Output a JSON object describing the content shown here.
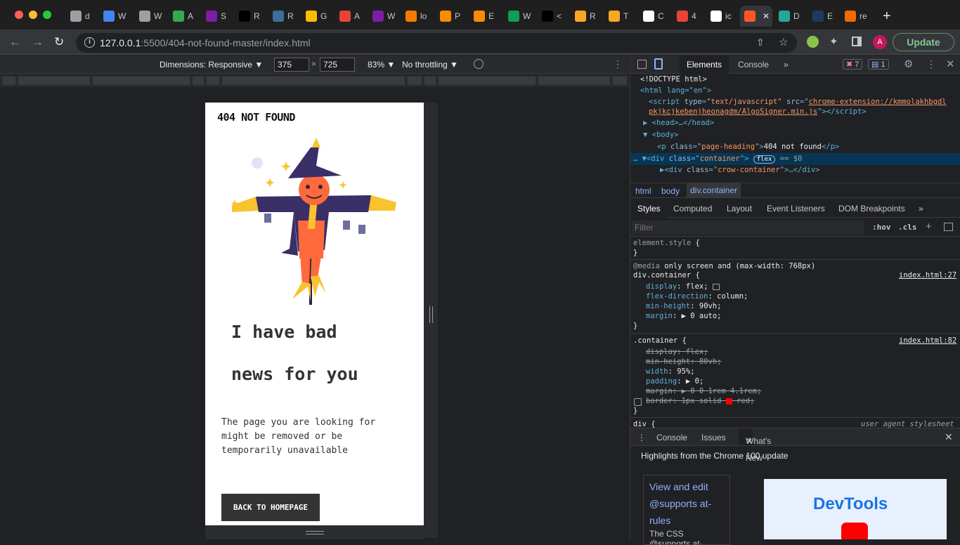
{
  "tabs": [
    {
      "label": "d",
      "color": "#9aa0a6"
    },
    {
      "label": "W",
      "color": "#4285f4"
    },
    {
      "label": "W",
      "color": "#9aa0a6"
    },
    {
      "label": "A",
      "color": "#34a853"
    },
    {
      "label": "S",
      "color": "#7b1fa2"
    },
    {
      "label": "R",
      "color": "#000000"
    },
    {
      "label": "R",
      "color": "#3c6e9f"
    },
    {
      "label": "G",
      "color": "#fbbc04"
    },
    {
      "label": "A",
      "color": "#ea4335"
    },
    {
      "label": "W",
      "color": "#7b1fa2"
    },
    {
      "label": "lo",
      "color": "#f57c00"
    },
    {
      "label": "P",
      "color": "#fb8c00"
    },
    {
      "label": "E",
      "color": "#fb8c00"
    },
    {
      "label": "W",
      "color": "#0f9d58"
    },
    {
      "label": "<",
      "color": "#000000"
    },
    {
      "label": "R",
      "color": "#f9a825"
    },
    {
      "label": "T",
      "color": "#f9a825"
    },
    {
      "label": "C",
      "color": "#ffffff"
    },
    {
      "label": "4",
      "color": "#ea4335"
    },
    {
      "label": "ic",
      "color": "#ffffff"
    },
    {
      "label": "",
      "color": "#ff5722"
    },
    {
      "label": "D",
      "color": "#26a69a"
    },
    {
      "label": "E",
      "color": "#1e3a5f"
    },
    {
      "label": "re",
      "color": "#ef6c00"
    }
  ],
  "address": {
    "host": "127.0.0.1",
    "path": ":5500/404-not-found-master/index.html",
    "update_label": "Update",
    "avatar": "A"
  },
  "device_toolbar": {
    "dimensions": "Dimensions: Responsive ▼",
    "width": "375",
    "height": "725",
    "zoom": "83% ▼",
    "throttle": "No throttling ▼"
  },
  "page": {
    "heading": "404 NOT FOUND",
    "line1": "I have bad",
    "line2": "news for you",
    "description": "The page you are looking for might be removed or be temporarily unavailable",
    "button": "BACK TO HOMEPAGE"
  },
  "devtools": {
    "tabs": [
      "Elements",
      "Console"
    ],
    "errors": "7",
    "messages": "1",
    "dom": {
      "doctype": "<!DOCTYPE html>",
      "html_open": "<html lang=\"en\">",
      "script_src": "chrome-extension://kmmolakhbgdl",
      "script_src2": "pkjkcjkebenjheonagdm/AlgoSigner.min.js",
      "head": "<head>…</head>",
      "body": "<body>",
      "p_text": "404 not found",
      "container": "container",
      "crow": "crow-container"
    },
    "breadcrumbs": [
      "html",
      "body",
      "div.container"
    ],
    "style_tabs": [
      "Styles",
      "Computed",
      "Layout",
      "Event Listeners",
      "DOM Breakpoints"
    ],
    "filter_placeholder": "Filter",
    "hov": ":hov",
    "cls": ".cls",
    "media": "only screen and (max-width: 768px)",
    "rule1_selector": "div.container {",
    "rule1_source": "index.html:27",
    "rule1": [
      {
        "p": "display",
        "v": "flex;"
      },
      {
        "p": "flex-direction",
        "v": "column;"
      },
      {
        "p": "min-height",
        "v": "90vh;"
      },
      {
        "p": "margin",
        "v": "▶ 0 auto;"
      }
    ],
    "rule2_selector": ".container {",
    "rule2_source": "index.html:82",
    "rule2_width": "95%;",
    "rule2_padding": "▶ 0;",
    "ua": "user agent stylesheet",
    "drawer_tabs": [
      "Console",
      "Issues",
      "What's New"
    ],
    "whats_new_title": "Highlights from the Chrome 100 update",
    "card_link": "View and edit @supports at-rules",
    "card_text": "The CSS @supports at-",
    "devtools_logo": "DevTools"
  }
}
